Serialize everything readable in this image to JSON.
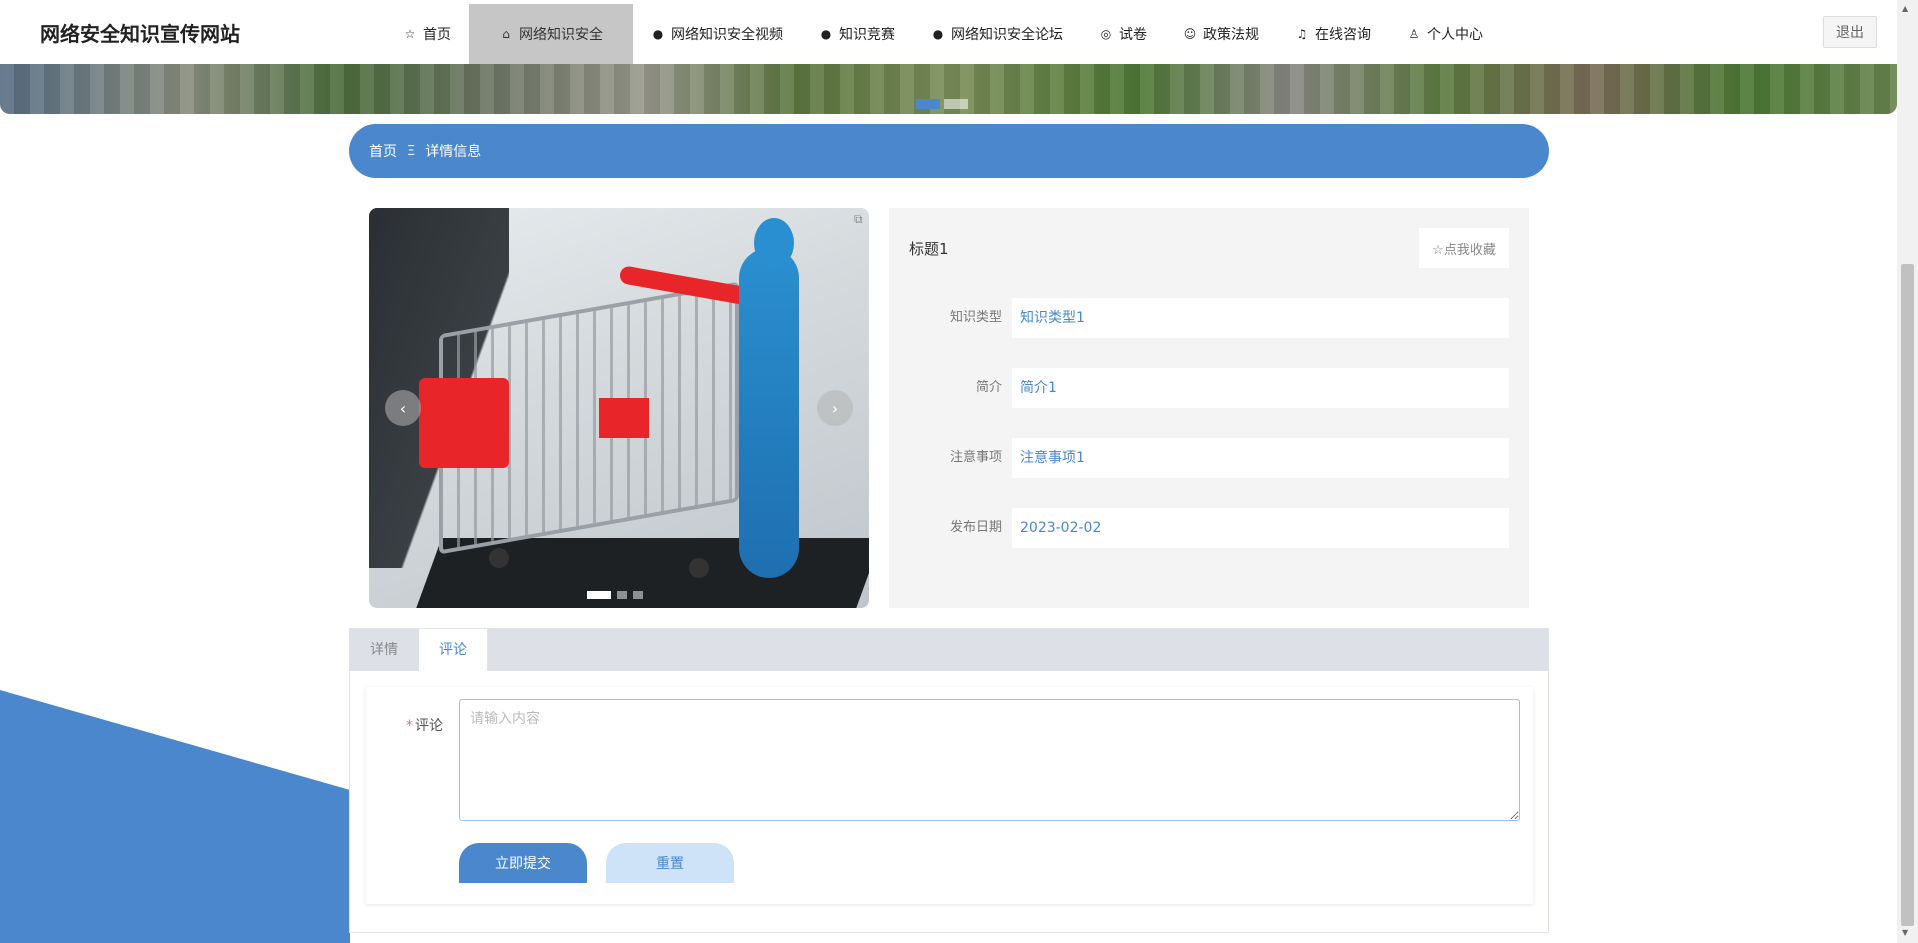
{
  "site": {
    "title": "网络安全知识宣传网站"
  },
  "nav": {
    "items": [
      {
        "icon": "star-icon",
        "label": "首页"
      },
      {
        "icon": "bag-icon",
        "label": "网络知识安全",
        "active": true
      },
      {
        "icon": "exclamation-icon",
        "label": "网络知识安全视频"
      },
      {
        "icon": "question-icon",
        "label": "知识竞赛"
      },
      {
        "icon": "info-icon",
        "label": "网络知识安全论坛"
      },
      {
        "icon": "help-icon",
        "label": "试卷"
      },
      {
        "icon": "smile-icon",
        "label": "政策法规"
      },
      {
        "icon": "headset-icon",
        "label": "在线咨询"
      },
      {
        "icon": "user-icon",
        "label": "个人中心"
      }
    ],
    "logout": "退出"
  },
  "breadcrumb": {
    "home": "首页",
    "separator": "Ξ",
    "current": "详情信息"
  },
  "detail": {
    "title": "标题1",
    "favorite": "☆点我收藏",
    "fields": [
      {
        "label": "知识类型",
        "value": "知识类型1"
      },
      {
        "label": "简介",
        "value": "简介1"
      },
      {
        "label": "注意事项",
        "value": "注意事项1"
      },
      {
        "label": "发布日期",
        "value": "2023-02-02"
      }
    ]
  },
  "tabs": [
    {
      "label": "详情"
    },
    {
      "label": "评论",
      "active": true
    }
  ],
  "comment": {
    "label": "评论",
    "required_mark": "*",
    "placeholder": "请输入内容",
    "submit": "立即提交",
    "reset": "重置"
  },
  "colors": {
    "accent": "#4a87cc",
    "accent_light": "#cfe3f8",
    "required": "#f56c6c"
  }
}
